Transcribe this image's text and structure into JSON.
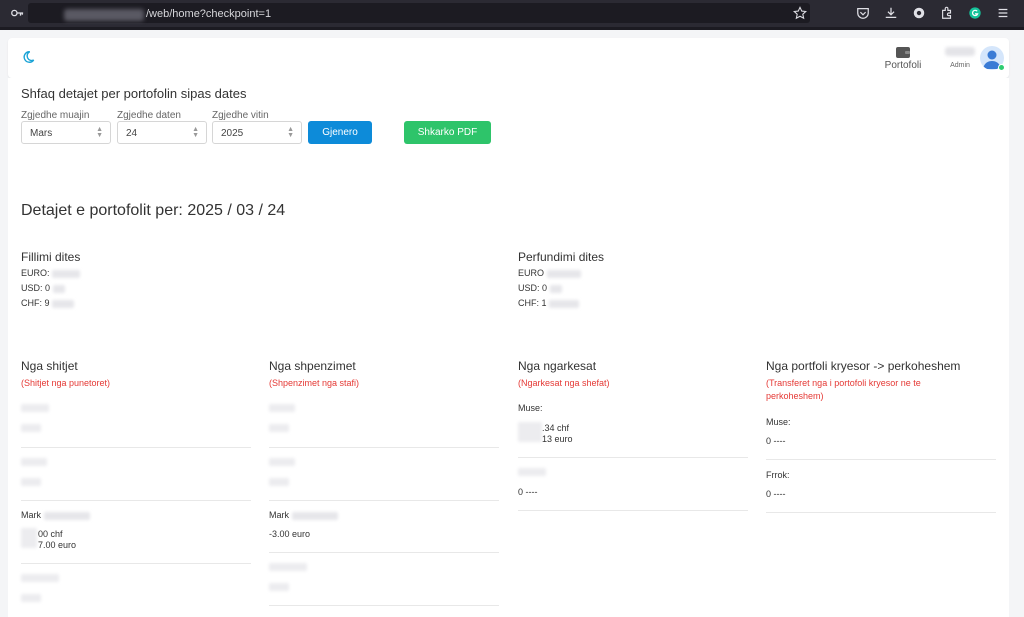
{
  "browser": {
    "url_visible": "/web/home?checkpoint=1"
  },
  "nav": {
    "portofoli_label": "Portofoli",
    "user_role": "Admin"
  },
  "filter": {
    "heading": "Shfaq detajet per portofolin sipas dates",
    "month_label": "Zgjedhe muajin",
    "month_value": "Mars",
    "day_label": "Zgjedhe daten",
    "day_value": "24",
    "year_label": "Zgjedhe vitin",
    "year_value": "2025",
    "generate_button": "Gjenero",
    "pdf_button": "Shkarko PDF"
  },
  "details": {
    "title": "Detajet e portofolit per: 2025 / 03 / 24",
    "start": {
      "title": "Fillimi dites",
      "euro_label": "EURO:",
      "usd_label": "USD:",
      "usd_value": "0",
      "chf_label": "CHF:",
      "chf_value": "9"
    },
    "end": {
      "title": "Perfundimi dites",
      "euro_label": "EURO",
      "usd_label": "USD:",
      "usd_value": "0",
      "chf_label": "CHF:",
      "chf_value": "1"
    }
  },
  "columns": {
    "sales": {
      "title": "Nga shitjet",
      "subtitle": "(Shitjet nga punetoret)",
      "row3_label": "Mark",
      "row3_val1": "00 chf",
      "row3_val2": "7.00 euro"
    },
    "expenses": {
      "title": "Nga shpenzimet",
      "subtitle": "(Shpenzimet nga stafi)",
      "row3_label": "Mark",
      "row3_val1": "-3.00 euro"
    },
    "loads": {
      "title": "Nga ngarkesat",
      "subtitle": "(Ngarkesat nga shefat)",
      "row1_label": "Muse:",
      "row1_val1": ".34 chf",
      "row1_val2": "13 euro",
      "row2_val": "0 ----"
    },
    "main_portfolio": {
      "title": "Nga portfoli kryesor -> perkoheshem",
      "subtitle_line1": "(Transferet nga i portofoli kryesor ne te",
      "subtitle_line2": "perkoheshem)",
      "row1_label": "Muse:",
      "row1_val": "0 ----",
      "row2_label": "Frrok:",
      "row2_val": "0 ----"
    }
  },
  "colors": {
    "primary_button": "#0d8bd9",
    "pdf_button": "#2ec46a",
    "subtitle_red": "#e53935",
    "online_dot": "#2ecc71"
  },
  "icons": [
    "key-icon",
    "star-icon",
    "pocket-icon",
    "download-icon",
    "extension-icon",
    "menu-icon",
    "moon-icon",
    "wallet-icon",
    "avatar-icon"
  ]
}
